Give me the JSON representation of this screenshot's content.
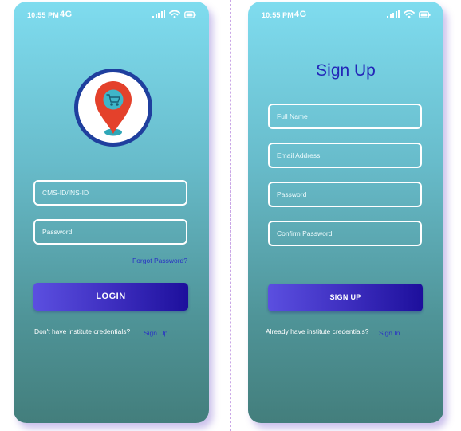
{
  "status_bar": {
    "time": "10:55 PM",
    "network": "4G"
  },
  "login": {
    "id_placeholder": "CMS-ID/INS-ID",
    "password_placeholder": "Password",
    "forgot_password": "Forgot Password?",
    "login_button": "LOGIN",
    "no_credentials_text": "Don't have institute credentials?",
    "sign_up_link": "Sign Up"
  },
  "signup": {
    "title": "Sign Up",
    "full_name_placeholder": "Full Name",
    "email_placeholder": "Email Address",
    "password_placeholder": "Password",
    "confirm_password_placeholder": "Confirm Password",
    "sign_up_button": "SIGN UP",
    "have_credentials_text": "Already have institute credentials?",
    "sign_in_link": "Sign In"
  },
  "colors": {
    "button_start": "#5b4fe0",
    "button_end": "#1d0f9c",
    "link": "#2a33c4",
    "title": "#2326b8",
    "logo_ring": "#1f3f9e",
    "pin_red": "#e4412b"
  }
}
